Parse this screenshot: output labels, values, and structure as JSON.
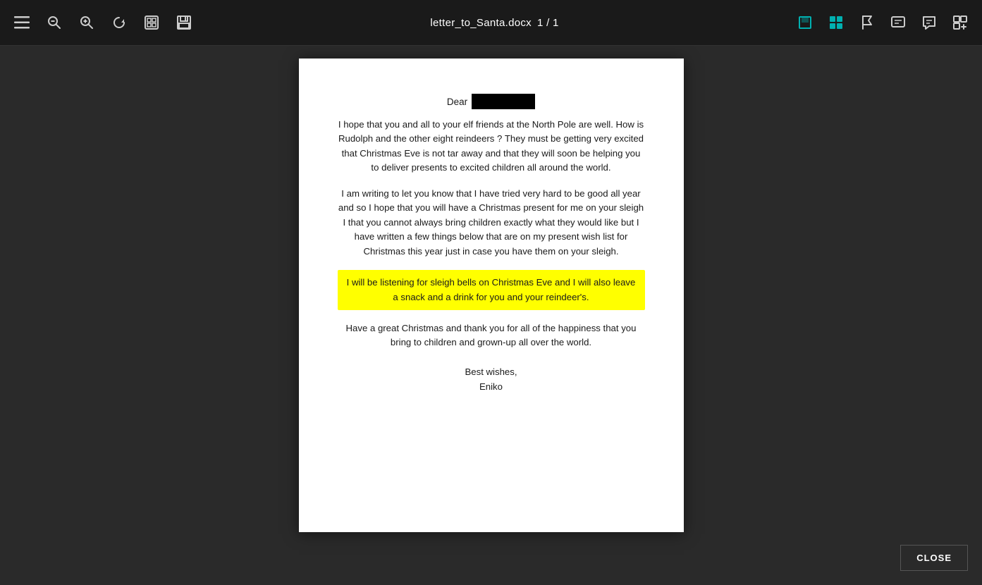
{
  "toolbar": {
    "title": "letter_to_Santa.docx",
    "pages": "1 / 1"
  },
  "document": {
    "greeting_prefix": "Dear",
    "paragraph1": "I hope that you and all to your elf friends at the North Pole are well. How is Rudolph and the other eight reindeers ? They must be getting very excited that Christmas Eve is not tar away and that they will soon be helping you to deliver presents to excited children all around the world.",
    "paragraph2": "I am writing to let you know that I have tried very hard to be good all year and so I hope that you will have a Christmas present for me on your sleigh I that you cannot always bring children exactly what they would like but I have written a few things below that are on my present wish list for Christmas this year just in case you have them on your sleigh.",
    "highlighted": "I will be listening for sleigh bells on Christmas Eve and I will also leave a snack and a drink for you and your reindeer's.",
    "paragraph3": "Have a great Christmas and thank you for all of the happiness that you bring to children and grown-up all over the world.",
    "closing": "Best wishes,",
    "signature": "Eniko"
  },
  "buttons": {
    "close": "CLOSE"
  },
  "icons": {
    "menu": "☰",
    "zoom_out": "−",
    "zoom_in": "+",
    "rotate": "↺",
    "snapshot": "⊞",
    "save": "💾",
    "grid1": "▣",
    "grid2": "⊞",
    "flag": "⚑",
    "comment1": "◻",
    "comment2": "💬",
    "comment3": "⋮"
  }
}
